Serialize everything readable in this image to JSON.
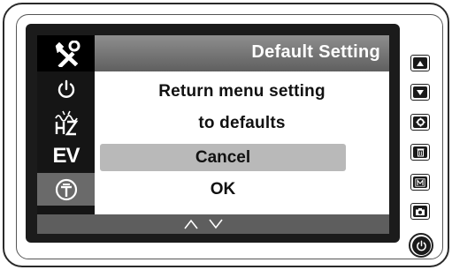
{
  "header": {
    "title": "Default Setting"
  },
  "sidebar": {
    "items": [
      {
        "icon": "tools-icon",
        "selected": true
      },
      {
        "icon": "power-icon"
      },
      {
        "icon": "flicker-hz-icon"
      },
      {
        "icon": "ev-icon",
        "label": "EV"
      },
      {
        "icon": "pin-circle-icon",
        "highlighted": true
      }
    ]
  },
  "dialog": {
    "line1": "Return menu setting",
    "line2": "to defaults",
    "options": [
      {
        "label": "Cancel",
        "selected": true
      },
      {
        "label": "OK",
        "selected": false
      }
    ]
  },
  "footer": {
    "nav": [
      "up-arrow-icon",
      "down-arrow-icon"
    ]
  },
  "hardware_buttons": [
    "up-button",
    "down-button",
    "settings-button",
    "delete-button",
    "mode-button",
    "camera-button",
    "power-button"
  ],
  "colors": {
    "title_bar": "#6f6f6f",
    "sidebar": "#151515",
    "selected_option": "#b9b9b9",
    "bottom_bar": "#5e5e5e"
  }
}
